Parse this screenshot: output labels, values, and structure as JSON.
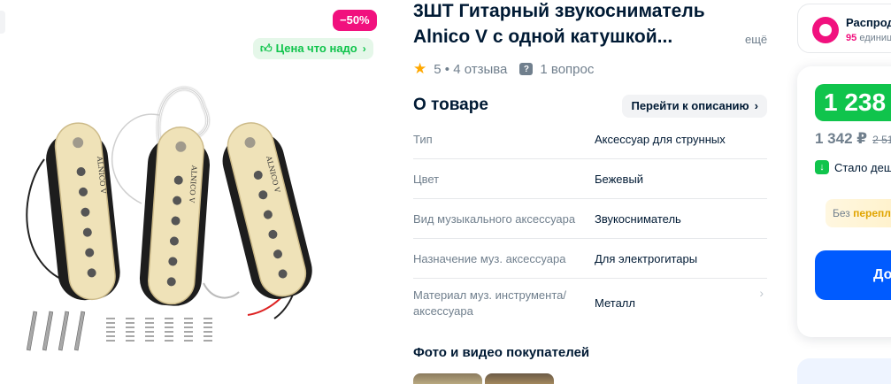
{
  "gallery": {
    "discount_badge": "−50%",
    "price_tag": "Цена что надо",
    "image_label": "ALNICO V"
  },
  "product": {
    "title": "3ШТ Гитарный звукосниматель Alnico V с одной катушкой...",
    "more_link": "ещё",
    "rating": "5",
    "reviews": "4 отзыва",
    "questions": "1 вопрос"
  },
  "about": {
    "title": "О товаре",
    "goto_description": "Перейти к описанию",
    "specs": [
      {
        "key": "Тип",
        "value": "Аксессуар для струнных"
      },
      {
        "key": "Цвет",
        "value": "Бежевый"
      },
      {
        "key": "Вид музыкального аксессуара",
        "value": "Звукосниматель"
      },
      {
        "key": "Назначение муз. аксессуара",
        "value": "Для электрогитары"
      },
      {
        "key": "Материал муз. инструмента/ аксессуара",
        "value": "Металл"
      }
    ]
  },
  "photos": {
    "title": "Фото и видео покупателей"
  },
  "seller": {
    "name": "Распрод",
    "sub_count": "95",
    "sub_text": "единиц"
  },
  "buy": {
    "price": "1 238 ₽",
    "old_price": "1 342 ₽",
    "strike_price": "2 51",
    "cheaper_text": "Стало деш",
    "promo_prefix": "Без ",
    "promo_highlight": "перепл",
    "cart_button": "До"
  },
  "colors": {
    "accent_pink": "#f1117e",
    "price_green": "#10c44c",
    "button_blue": "#005bff",
    "text_dark": "#001a34",
    "text_muted": "#707f8d"
  }
}
